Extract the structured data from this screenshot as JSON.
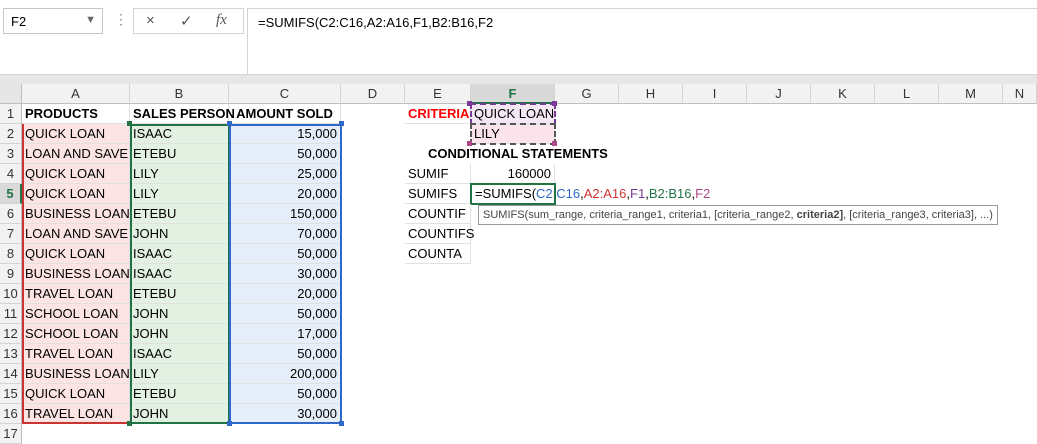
{
  "formula_bar": {
    "name_box": "F2",
    "cancel_icon": "×",
    "enter_icon": "✓",
    "fx_label": "fx",
    "formula": "=SUMIFS(C2:C16,A2:A16,F1,B2:B16,F2"
  },
  "columns": [
    "A",
    "B",
    "C",
    "D",
    "E",
    "F",
    "G",
    "H",
    "I",
    "J",
    "K",
    "L",
    "M",
    "N"
  ],
  "rows": [
    "1",
    "2",
    "3",
    "4",
    "5",
    "6",
    "7",
    "8",
    "9",
    "10",
    "11",
    "12",
    "13",
    "14",
    "15",
    "16",
    "17"
  ],
  "headers": {
    "products": "PRODUCTS",
    "sales_person": "SALES PERSON",
    "amount_sold": "AMOUNT SOLD"
  },
  "table": [
    {
      "product": "QUICK LOAN",
      "person": "ISAAC",
      "amount": "15,000"
    },
    {
      "product": "LOAN AND SAVE",
      "person": "ETEBU",
      "amount": "50,000"
    },
    {
      "product": "QUICK LOAN",
      "person": "LILY",
      "amount": "25,000"
    },
    {
      "product": "QUICK LOAN",
      "person": "LILY",
      "amount": "20,000"
    },
    {
      "product": "BUSINESS LOAN",
      "person": "ETEBU",
      "amount": "150,000"
    },
    {
      "product": "LOAN AND SAVE",
      "person": "JOHN",
      "amount": "70,000"
    },
    {
      "product": "QUICK LOAN",
      "person": "ISAAC",
      "amount": "50,000"
    },
    {
      "product": "BUSINESS LOAN",
      "person": "ISAAC",
      "amount": "30,000"
    },
    {
      "product": "TRAVEL LOAN",
      "person": "ETEBU",
      "amount": "20,000"
    },
    {
      "product": "SCHOOL LOAN",
      "person": "JOHN",
      "amount": "50,000"
    },
    {
      "product": "SCHOOL LOAN",
      "person": "JOHN",
      "amount": "17,000"
    },
    {
      "product": "TRAVEL LOAN",
      "person": "ISAAC",
      "amount": "50,000"
    },
    {
      "product": "BUSINESS LOAN",
      "person": "LILY",
      "amount": "200,000"
    },
    {
      "product": "QUICK LOAN",
      "person": "ETEBU",
      "amount": "50,000"
    },
    {
      "product": "TRAVEL LOAN",
      "person": "JOHN",
      "amount": "30,000"
    }
  ],
  "criteria": {
    "label": "CRITERIA",
    "value1": "QUICK LOAN",
    "value2": "LILY"
  },
  "conditional": {
    "title": "CONDITIONAL STATEMENTS",
    "sumif_label": "SUMIF",
    "sumif_value": "160000",
    "sumifs_label": "SUMIFS",
    "countif_label": "COUNTIF",
    "countifs_label": "COUNTIFS",
    "counta_label": "COUNTA"
  },
  "editing": {
    "p0": "=SUMIFS(",
    "p1": "C2:C16",
    "p2": ",",
    "p3": "A2:A16",
    "p4": ",",
    "p5": "F1",
    "p6": ",",
    "p7": "B2:B16",
    "p8": ",",
    "p9": "F2"
  },
  "tooltip": {
    "pre": "SUMIFS(sum_range, criteria_range1, criteria1, [criteria_range2, ",
    "bold": "criteria2]",
    "post": ", [criteria_range3, criteria3], ...)"
  },
  "colors": {
    "range_c": "#2f69c7",
    "range_a": "#cc3333",
    "range_b": "#217346",
    "range_f1": "#7a3a9a",
    "range_f2": "#b04a8a",
    "excel_green": "#217346"
  }
}
